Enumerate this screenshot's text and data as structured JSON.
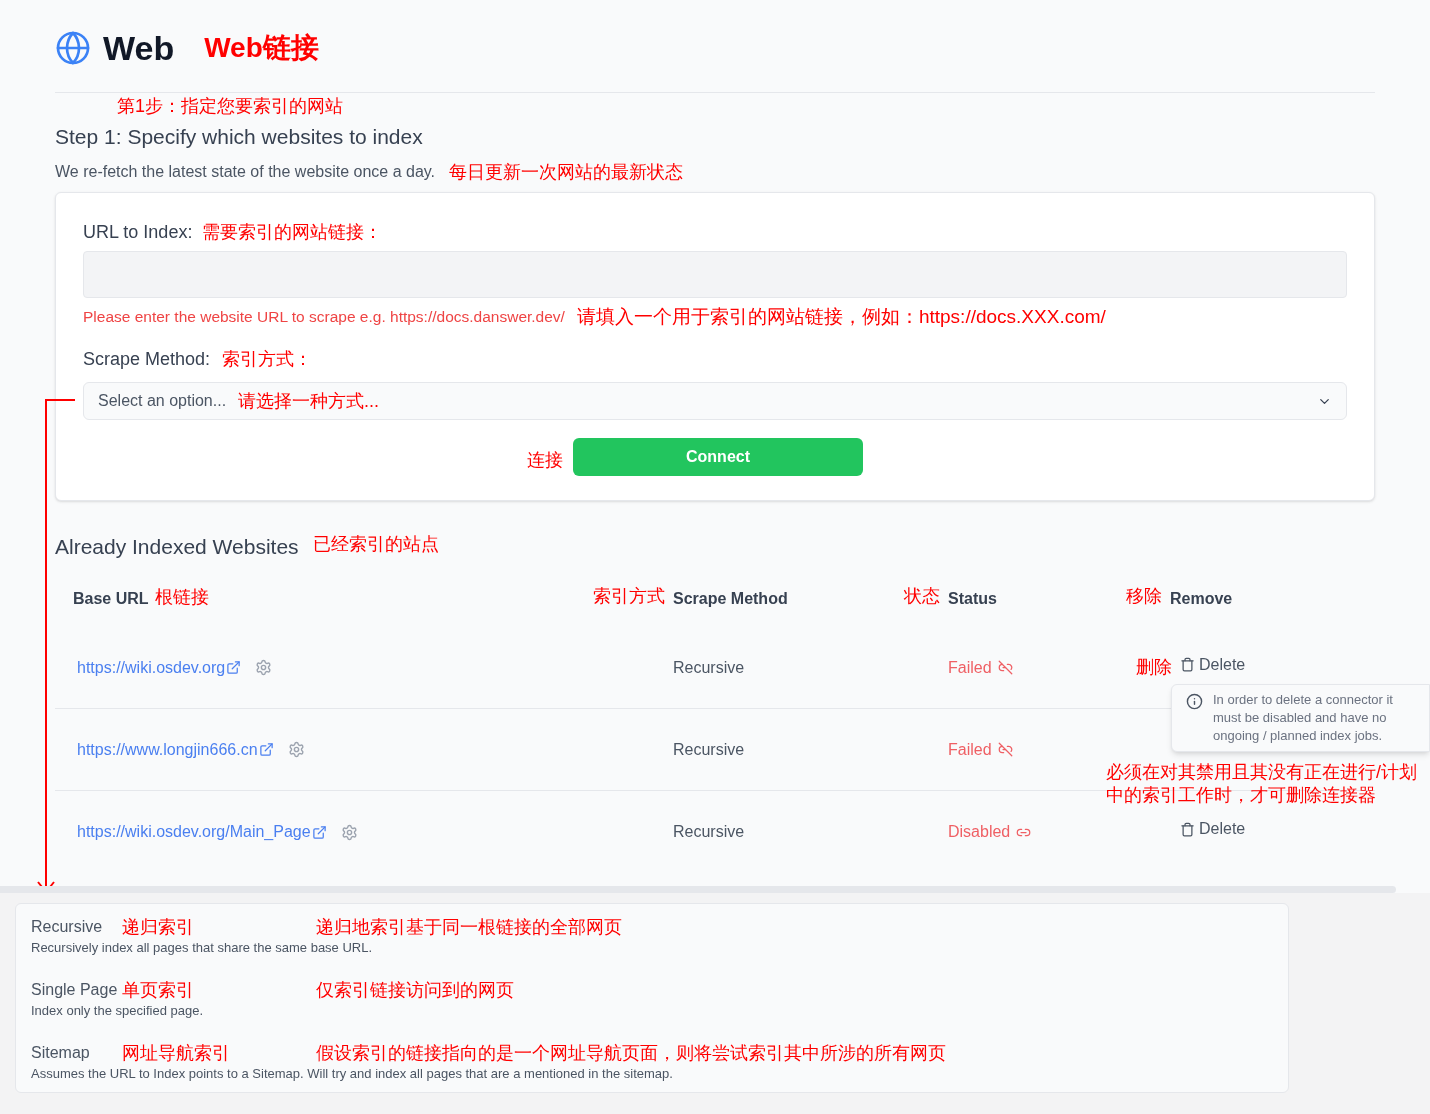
{
  "header": {
    "title": "Web",
    "annotation": "Web链接"
  },
  "step": {
    "annotation": "第1步：指定您要索引的网站",
    "title": "Step 1: Specify which websites to index",
    "description": "We re-fetch the latest state of the website once a day.",
    "description_annotation": "每日更新一次网站的最新状态"
  },
  "form": {
    "url_label": "URL to Index:",
    "url_annotation": "需要索引的网站链接：",
    "url_error": "Please enter the website URL to scrape e.g. https://docs.danswer.dev/",
    "url_error_annotation": "请填入一个用于索引的网站链接，例如：https://docs.XXX.com/",
    "method_label": "Scrape Method:",
    "method_annotation": "索引方式：",
    "select_placeholder": "Select an option...",
    "select_annotation": "请选择一种方式...",
    "connect_annotation": "连接",
    "connect_button": "Connect"
  },
  "indexed": {
    "title": "Already Indexed Websites",
    "annotation": "已经索引的站点",
    "columns": [
      {
        "label": "Base URL",
        "annotation": "根链接"
      },
      {
        "label": "Scrape Method",
        "annotation": "索引方式"
      },
      {
        "label": "Status",
        "annotation": "状态"
      },
      {
        "label": "Remove",
        "annotation": "移除"
      }
    ],
    "rows": [
      {
        "url": "https://wiki.osdev.org",
        "method": "Recursive",
        "status": "Failed",
        "kind": "failed",
        "delete": "Delete",
        "delete_annotation": "删除"
      },
      {
        "url": "https://www.longjin666.cn",
        "method": "Recursive",
        "status": "Failed",
        "kind": "failed"
      },
      {
        "url": "https://wiki.osdev.org/Main_Page",
        "method": "Recursive",
        "status": "Disabled",
        "kind": "disabled",
        "delete": "Delete"
      }
    ],
    "tooltip": {
      "text": "In order to delete a connector it must be disabled and have no ongoing / planned index jobs.",
      "annotation": "必须在对其禁用且其没有正在进行/计划中的索引工作时，才可删除连接器"
    }
  },
  "dropdown": {
    "options": [
      {
        "label": "Recursive",
        "annotation": "递归索引",
        "description": "Recursively index all pages that share the same base URL.",
        "description_annotation": "递归地索引基于同一根链接的全部网页"
      },
      {
        "label": "Single Page",
        "annotation": "单页索引",
        "description": "Index only the specified page.",
        "description_annotation": "仅索引链接访问到的网页"
      },
      {
        "label": "Sitemap",
        "annotation": "网址导航索引",
        "description": "Assumes the URL to Index points to a Sitemap. Will try and index all pages that are a mentioned in the sitemap.",
        "description_annotation": "假设索引的链接指向的是一个网址导航页面，则将尝试索引其中所涉的所有网页"
      }
    ]
  }
}
